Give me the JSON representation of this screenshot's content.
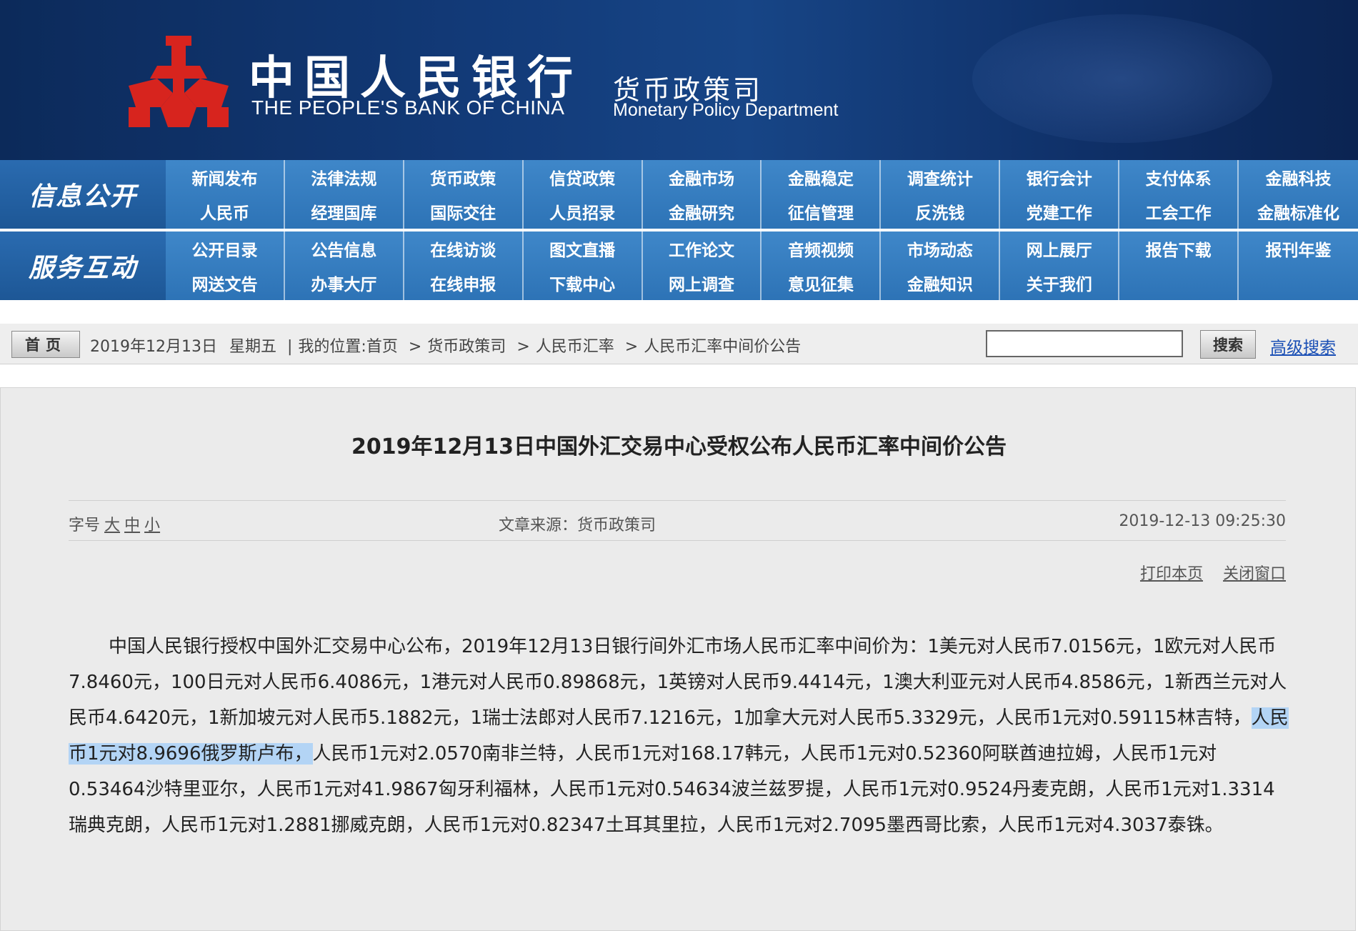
{
  "header": {
    "bank_name_cn": "中国人民银行",
    "bank_name_en": "THE PEOPLE'S BANK OF CHINA",
    "dept_cn": "货币政策司",
    "dept_en": "Monetary Policy Department",
    "logo_color": "#d7241e"
  },
  "nav": {
    "section1_label": "信息公开",
    "section1_items": [
      "新闻发布",
      "法律法规",
      "货币政策",
      "信贷政策",
      "金融市场",
      "金融稳定",
      "调查统计",
      "银行会计",
      "支付体系",
      "金融科技",
      "人民币",
      "经理国库",
      "国际交往",
      "人员招录",
      "金融研究",
      "征信管理",
      "反洗钱",
      "党建工作",
      "工会工作",
      "金融标准化"
    ],
    "section2_label": "服务互动",
    "section2_items": [
      "公开目录",
      "公告信息",
      "在线访谈",
      "图文直播",
      "工作论文",
      "音频视频",
      "市场动态",
      "网上展厅",
      "报告下载",
      "报刊年鉴",
      "网送文告",
      "办事大厅",
      "在线申报",
      "下载中心",
      "网上调查",
      "意见征集",
      "金融知识",
      "关于我们",
      "",
      ""
    ]
  },
  "breadcrumb": {
    "home_button": "首页",
    "date": "2019年12月13日",
    "weekday": "星期五",
    "location_label": "我的位置:",
    "crumbs": [
      "首页",
      "货币政策司",
      "人民币汇率",
      "人民币汇率中间价公告"
    ],
    "search_button": "搜索",
    "search_value": "",
    "advanced_search": "高级搜索"
  },
  "article": {
    "title": "2019年12月13日中国外汇交易中心受权公布人民币汇率中间价公告",
    "font_size_label": "字号",
    "font_size_options": [
      "大",
      "中",
      "小"
    ],
    "source": "文章来源：货币政策司",
    "datetime": "2019-12-13 09:25:30",
    "print_link": "打印本页",
    "close_link": "关闭窗口",
    "body_before": "中国人民银行授权中国外汇交易中心公布，2019年12月13日银行间外汇市场人民币汇率中间价为：1美元对人民币7.0156元，1欧元对人民币7.8460元，100日元对人民币6.4086元，1港元对人民币0.89868元，1英镑对人民币9.4414元，1澳大利亚元对人民币4.8586元，1新西兰元对人民币4.6420元，1新加坡元对人民币5.1882元，1瑞士法郎对人民币7.1216元，1加拿大元对人民币5.3329元，人民币1元对0.59115林吉特，",
    "body_highlight": "人民币1元对8.9696俄罗斯卢布，",
    "body_after": "人民币1元对2.0570南非兰特，人民币1元对168.17韩元，人民币1元对0.52360阿联酋迪拉姆，人民币1元对0.53464沙特里亚尔，人民币1元对41.9867匈牙利福林，人民币1元对0.54634波兰兹罗提，人民币1元对0.9524丹麦克朗，人民币1元对1.3314瑞典克朗，人民币1元对1.2881挪威克朗，人民币1元对0.82347土耳其里拉，人民币1元对2.7095墨西哥比索，人民币1元对4.3037泰铢。"
  }
}
